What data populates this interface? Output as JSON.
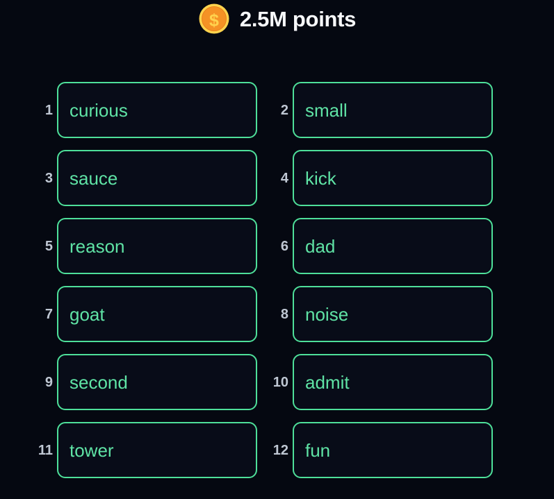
{
  "header": {
    "coin_icon": "coin-dollar-icon",
    "score_label": "2.5M points",
    "score_value": "2.5M",
    "score_unit": "points",
    "coin_colors": {
      "rim": "#ffd34d",
      "face": "#f59225",
      "symbol": "#ffcf4a"
    },
    "text_color": "#f7f8fb"
  },
  "theme": {
    "background": "#050811",
    "box_background": "#080c18",
    "box_border": "#4ee09a",
    "word_text": "#5fe3a5",
    "index_text": "#bfc7d3"
  },
  "word_list": {
    "count": 12,
    "columns": 2,
    "items": [
      {
        "index": "1",
        "word": "curious"
      },
      {
        "index": "2",
        "word": "small"
      },
      {
        "index": "3",
        "word": "sauce"
      },
      {
        "index": "4",
        "word": "kick"
      },
      {
        "index": "5",
        "word": "reason"
      },
      {
        "index": "6",
        "word": "dad"
      },
      {
        "index": "7",
        "word": "goat"
      },
      {
        "index": "8",
        "word": "noise"
      },
      {
        "index": "9",
        "word": "second"
      },
      {
        "index": "10",
        "word": "admit"
      },
      {
        "index": "11",
        "word": "tower"
      },
      {
        "index": "12",
        "word": "fun"
      }
    ]
  }
}
